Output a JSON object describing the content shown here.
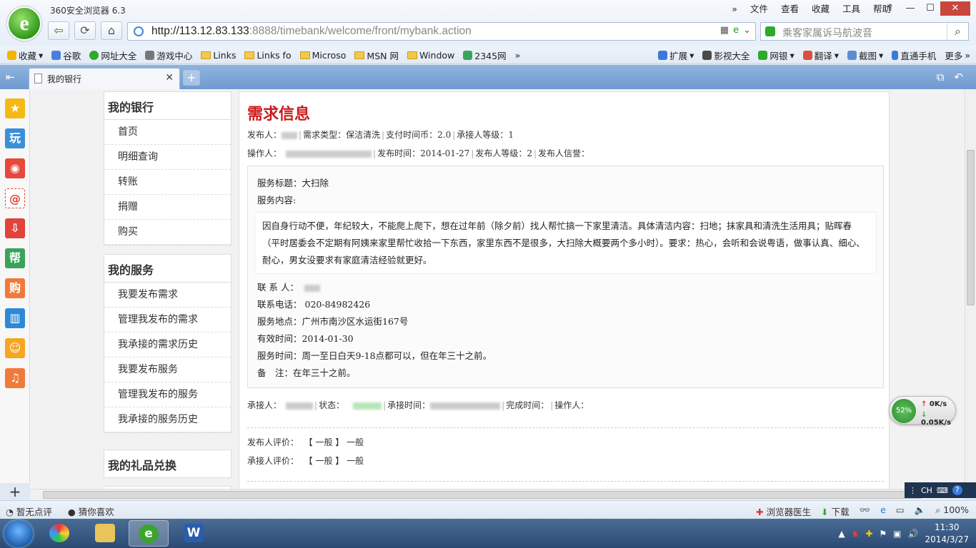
{
  "browser": {
    "title": "360安全浏览器 6.3",
    "menu": [
      "»",
      "文件",
      "查看",
      "收藏",
      "工具",
      "帮助"
    ],
    "url_host": "http://113.12.83.133",
    "url_rest": ":8888/timebank/welcome/front/mybank.action",
    "search_placeholder": "乘客家属诉马航波音",
    "bookmarks": [
      "收藏",
      "谷歌",
      "网址大全",
      "游戏中心",
      "Links",
      "Links fo",
      "Microso",
      "MSN 网",
      "Window",
      "2345网",
      "»"
    ],
    "bookmarks_right": [
      "扩展",
      "影视大全",
      "网银",
      "翻译",
      "截图",
      "直通手机",
      "更多"
    ],
    "tab_title": "我的银行"
  },
  "nav": {
    "bank": {
      "title": "我的银行",
      "items": [
        "首页",
        "明细查询",
        "转账",
        "捐赠",
        "购买"
      ]
    },
    "service": {
      "title": "我的服务",
      "items": [
        "我要发布需求",
        "管理我发布的需求",
        "我承接的需求历史",
        "我要发布服务",
        "管理我发布的服务",
        "我承接的服务历史"
      ]
    },
    "gift": {
      "title": "我的礼品兑换"
    }
  },
  "main": {
    "heading": "需求信息",
    "publisher_label": "发布人：",
    "type_label": "需求类型：",
    "type_value": "保洁清洗",
    "pay_label": "支付时间币：",
    "pay_value": "2.0",
    "taker_level_label": "承接人等级：",
    "taker_level_value": "1",
    "operator_label": "操作人：",
    "publish_time_label": "发布时间：",
    "publish_time_value": "2014-01-27",
    "publisher_level_label": "发布人等级：",
    "publisher_level_value": "2",
    "credit_label": "发布人信誉：",
    "detail": {
      "title_label": "服务标题：",
      "title_value": "大扫除",
      "content_label": "服务内容:",
      "content": "因自身行动不便，年纪较大，不能爬上爬下，想在过年前（除夕前）找人帮忙搞一下家里清洁。具体清洁内容：扫地；抹家具和清洗生活用具；贴晖春（平时居委会不定期有阿姨来家里帮忙收拾一下东西，家里东西不是很多，大扫除大概要两个多小时）。要求：热心，会听和会说粤语，做事认真、细心、耐心，男女没要求有家庭清洁经验就更好。",
      "contact_label": "联 系 人：",
      "phone_label": "联系电话：",
      "phone_value": "020-84982426",
      "location_label": "服务地点：",
      "location_value": "广州市南沙区水运街167号",
      "valid_label": "有效时间：",
      "valid_value": "2014-01-30",
      "service_time_label": "服务时间：",
      "service_time_value": "周一至日白天9-18点都可以，但在年三十之前。",
      "remark_label": "备　注：",
      "remark_value": "在年三十之前。"
    },
    "taker_label": "承接人：",
    "status_label": "状态：",
    "take_time_label": "承接时间：",
    "finish_time_label": "完成时间：",
    "operator2_label": "操作人：",
    "pub_eval_label": "发布人评价：",
    "take_eval_label": "承接人评价：",
    "eval_bracket": "【 一般 】",
    "eval_value": "一般"
  },
  "speed": {
    "percent": "52%",
    "up": "0K/s",
    "down": "0.05K/s"
  },
  "ime": {
    "label": "CH"
  },
  "status": {
    "left": [
      "暂无点评",
      "猜你喜欢"
    ],
    "doctor": "浏览器医生",
    "download": "下载",
    "zoom": "100%"
  },
  "clock": {
    "time": "11:30",
    "date": "2014/3/27"
  }
}
